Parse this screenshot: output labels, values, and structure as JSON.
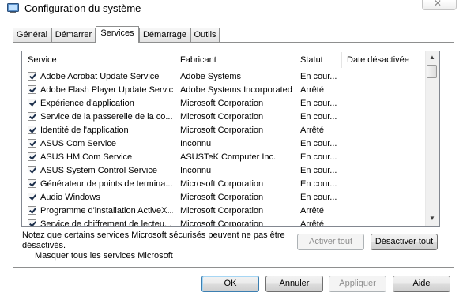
{
  "window": {
    "title": "Configuration du système",
    "close_symbol": "✕"
  },
  "tabs": [
    {
      "label": "Général",
      "active": false
    },
    {
      "label": "Démarrer",
      "active": false
    },
    {
      "label": "Services",
      "active": true
    },
    {
      "label": "Démarrage",
      "active": false
    },
    {
      "label": "Outils",
      "active": false
    }
  ],
  "table": {
    "headers": {
      "service": "Service",
      "manufacturer": "Fabricant",
      "status": "Statut",
      "disabled_date": "Date désactivée"
    },
    "rows": [
      {
        "checked": true,
        "service": "Adobe Acrobat Update Service",
        "manufacturer": "Adobe Systems",
        "status": "En cour...",
        "disabled_date": ""
      },
      {
        "checked": true,
        "service": "Adobe Flash Player Update Service",
        "manufacturer": "Adobe Systems Incorporated",
        "status": "Arrêté",
        "disabled_date": ""
      },
      {
        "checked": true,
        "service": "Expérience d'application",
        "manufacturer": "Microsoft Corporation",
        "status": "En cour...",
        "disabled_date": ""
      },
      {
        "checked": true,
        "service": "Service de la passerelle de la co...",
        "manufacturer": "Microsoft Corporation",
        "status": "En cour...",
        "disabled_date": ""
      },
      {
        "checked": true,
        "service": "Identité de l'application",
        "manufacturer": "Microsoft Corporation",
        "status": "Arrêté",
        "disabled_date": ""
      },
      {
        "checked": true,
        "service": "ASUS Com Service",
        "manufacturer": "Inconnu",
        "status": "En cour...",
        "disabled_date": ""
      },
      {
        "checked": true,
        "service": "ASUS HM Com Service",
        "manufacturer": "ASUSTeK Computer Inc.",
        "status": "En cour...",
        "disabled_date": ""
      },
      {
        "checked": true,
        "service": "ASUS System Control Service",
        "manufacturer": "Inconnu",
        "status": "En cour...",
        "disabled_date": ""
      },
      {
        "checked": true,
        "service": "Générateur de points de termina...",
        "manufacturer": "Microsoft Corporation",
        "status": "En cour...",
        "disabled_date": ""
      },
      {
        "checked": true,
        "service": "Audio Windows",
        "manufacturer": "Microsoft Corporation",
        "status": "En cour...",
        "disabled_date": ""
      },
      {
        "checked": true,
        "service": "Programme d'installation ActiveX...",
        "manufacturer": "Microsoft Corporation",
        "status": "Arrêté",
        "disabled_date": ""
      },
      {
        "checked": true,
        "service": "Service de chiffrement de lecteu...",
        "manufacturer": "Microsoft Corporation",
        "status": "Arrêté",
        "disabled_date": ""
      }
    ]
  },
  "scrollbar": {
    "up_arrow": "▲",
    "down_arrow": "▼"
  },
  "notice": "Notez que certains services Microsoft sécurisés peuvent ne pas être désactivés.",
  "hide_microsoft": {
    "label": "Masquer tous les services Microsoft",
    "checked": false
  },
  "buttons": {
    "enable_all": "Activer tout",
    "disable_all": "Désactiver tout",
    "ok": "OK",
    "cancel": "Annuler",
    "apply": "Appliquer",
    "help": "Aide"
  },
  "colors": {
    "border": "#8e8f8f",
    "list_border": "#828790",
    "default_button_border": "#3c7fb1"
  }
}
